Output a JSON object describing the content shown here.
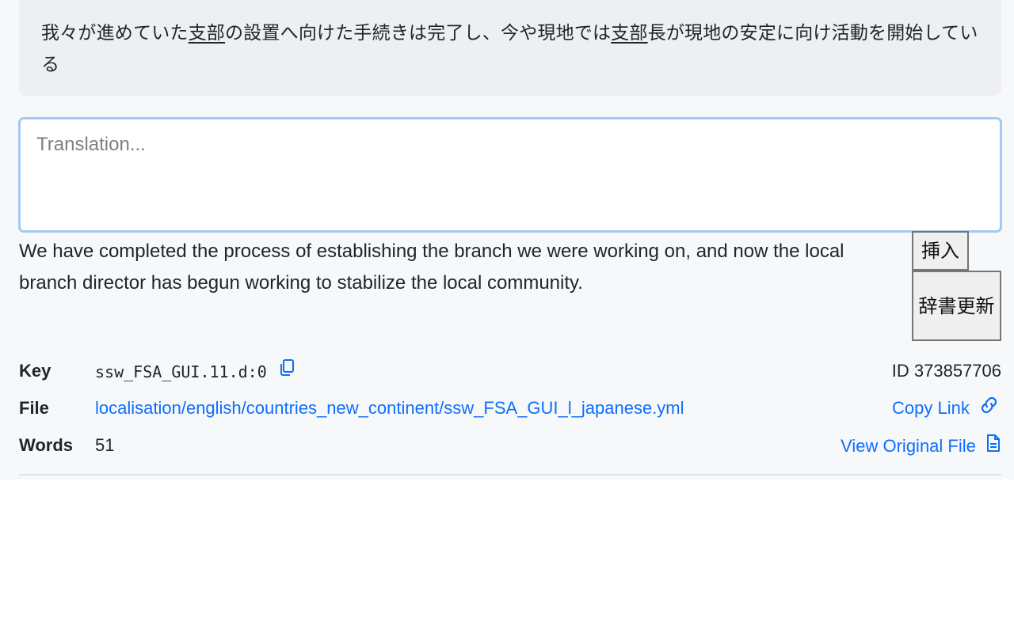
{
  "source": {
    "segments": [
      {
        "text": "我々が進めていた",
        "underline": false
      },
      {
        "text": "支部",
        "underline": true
      },
      {
        "text": "の設置へ向けた手続きは完了し、今や現地では",
        "underline": false
      },
      {
        "text": "支部",
        "underline": true
      },
      {
        "text": "長が現地の安定に向け活動を開始している",
        "underline": false
      }
    ]
  },
  "translation": {
    "placeholder": "Translation...",
    "value": ""
  },
  "suggestion": {
    "text": "We have completed the process of establishing the branch we were working on, and now the local branch director has begun working to stabilize the local community."
  },
  "buttons": {
    "insert_label": "挿入",
    "dict_update_label": "辞書更新"
  },
  "meta": {
    "key_label": "Key",
    "key_value": "ssw_FSA_GUI.11.d:0",
    "id_text": "ID 373857706",
    "file_label": "File",
    "file_value": "localisation/english/countries_new_continent/ssw_FSA_GUI_l_japanese.yml",
    "copy_link_label": "Copy Link",
    "words_label": "Words",
    "words_value": "51",
    "view_original_label": "View Original File"
  },
  "icons": {
    "copy": "copy-icon",
    "link": "link-icon",
    "file": "file-text-icon"
  },
  "colors": {
    "link": "#0d6efd",
    "focus_border": "#a3c9f5",
    "source_bg": "#eeeff1"
  }
}
